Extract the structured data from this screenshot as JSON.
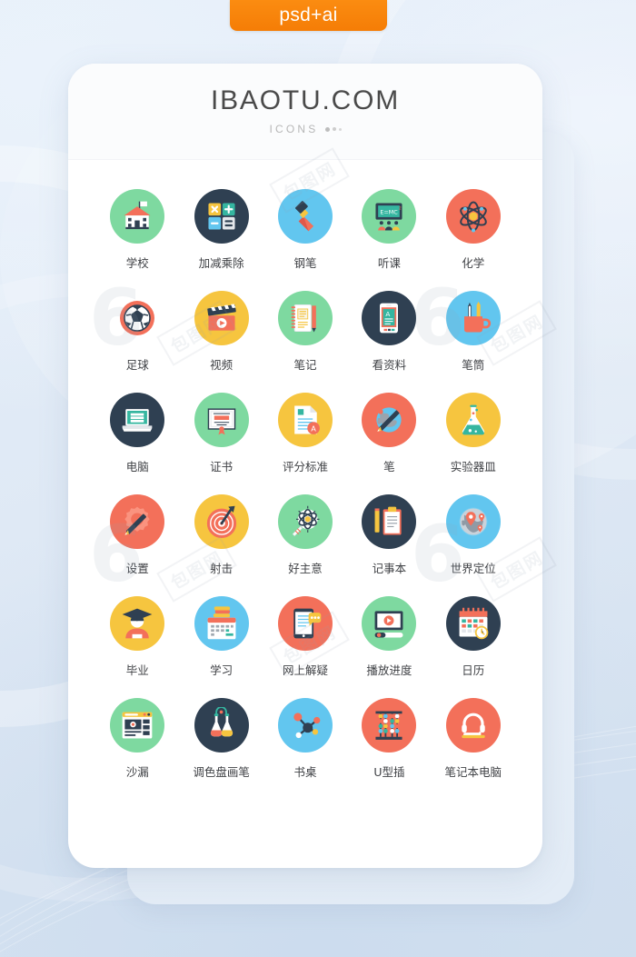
{
  "badge": {
    "label": "psd+ai",
    "color": "#f57d06"
  },
  "header": {
    "brand": "IBAOTU.COM",
    "subtitle": "ICONS"
  },
  "watermark": {
    "text": "包图网",
    "mark": "6"
  },
  "icons": [
    {
      "label": "学校",
      "name": "school-icon",
      "bg": "#7ed9a0"
    },
    {
      "label": "加减乘除",
      "name": "calculator-icon",
      "bg": "#2f4052"
    },
    {
      "label": "钢笔",
      "name": "fountain-pen-icon",
      "bg": "#62c6ef"
    },
    {
      "label": "听课",
      "name": "lecture-icon",
      "bg": "#7ed9a0"
    },
    {
      "label": "化学",
      "name": "atom-chemistry-icon",
      "bg": "#f3705a"
    },
    {
      "label": "足球",
      "name": "soccer-ball-icon",
      "bg": "#ffffff"
    },
    {
      "label": "视频",
      "name": "video-clapper-icon",
      "bg": "#f6c53f"
    },
    {
      "label": "笔记",
      "name": "notebook-icon",
      "bg": "#7ed9a0"
    },
    {
      "label": "看资料",
      "name": "reading-phone-icon",
      "bg": "#2f4052"
    },
    {
      "label": "笔筒",
      "name": "pen-holder-icon",
      "bg": "#62c6ef"
    },
    {
      "label": "电脑",
      "name": "laptop-books-icon",
      "bg": "#2f4052"
    },
    {
      "label": "证书",
      "name": "certificate-icon",
      "bg": "#7ed9a0"
    },
    {
      "label": "评分标准",
      "name": "grading-sheet-icon",
      "bg": "#f6c53f"
    },
    {
      "label": "笔",
      "name": "pencil-globe-icon",
      "bg": "#f3705a"
    },
    {
      "label": "实验器皿",
      "name": "flask-icon",
      "bg": "#f6c53f"
    },
    {
      "label": "设置",
      "name": "settings-pencil-icon",
      "bg": "#f3705a"
    },
    {
      "label": "射击",
      "name": "target-dart-icon",
      "bg": "#f6c53f"
    },
    {
      "label": "好主意",
      "name": "idea-bulb-icon",
      "bg": "#7ed9a0"
    },
    {
      "label": "记事本",
      "name": "clipboard-pencil-icon",
      "bg": "#2f4052"
    },
    {
      "label": "世界定位",
      "name": "world-location-icon",
      "bg": "#62c6ef"
    },
    {
      "label": "毕业",
      "name": "graduate-icon",
      "bg": "#f6c53f"
    },
    {
      "label": "学习",
      "name": "study-calendar-icon",
      "bg": "#62c6ef"
    },
    {
      "label": "网上解疑",
      "name": "online-qa-icon",
      "bg": "#f3705a"
    },
    {
      "label": "播放进度",
      "name": "play-progress-icon",
      "bg": "#7ed9a0"
    },
    {
      "label": "日历",
      "name": "calendar-clock-icon",
      "bg": "#2f4052"
    },
    {
      "label": "沙漏",
      "name": "browser-window-icon",
      "bg": "#7ed9a0"
    },
    {
      "label": "调色盘画笔",
      "name": "lab-flasks-icon",
      "bg": "#2f4052"
    },
    {
      "label": "书桌",
      "name": "molecule-icon",
      "bg": "#62c6ef"
    },
    {
      "label": "U型插",
      "name": "abacus-icon",
      "bg": "#f3705a"
    },
    {
      "label": "笔记本电脑",
      "name": "headset-icon",
      "bg": "#f3705a"
    }
  ]
}
